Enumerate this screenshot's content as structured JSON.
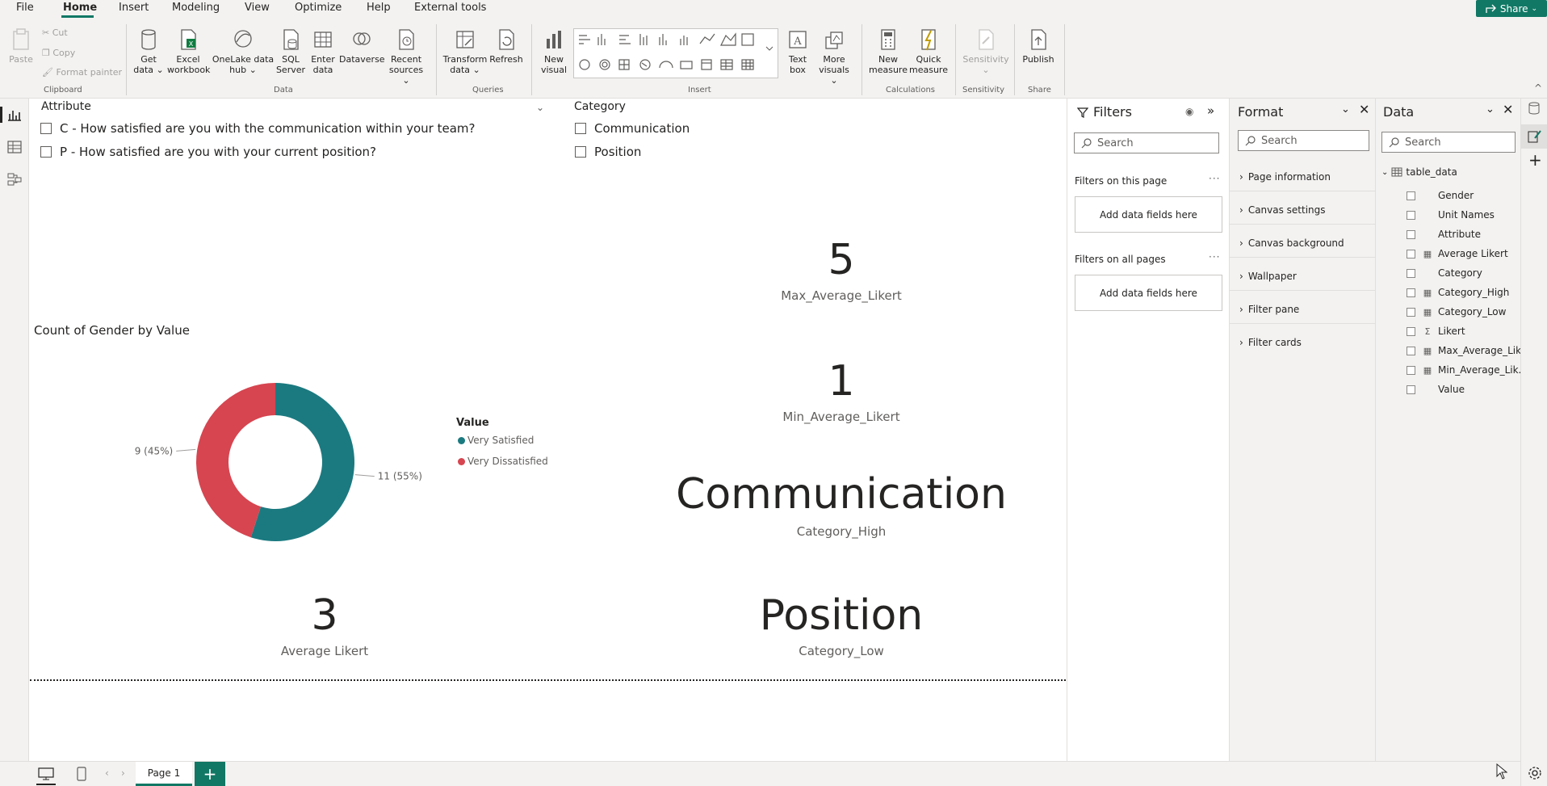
{
  "menu": {
    "items": [
      "File",
      "Home",
      "Insert",
      "Modeling",
      "View",
      "Optimize",
      "Help",
      "External tools"
    ],
    "share_label": "Share"
  },
  "ribbon": {
    "clipboard": {
      "paste": "Paste",
      "cut": "Cut",
      "copy": "Copy",
      "format_painter": "Format painter",
      "group": "Clipboard"
    },
    "data": {
      "get_data": "Get data",
      "excel": "Excel workbook",
      "onelake": "OneLake data hub",
      "sql": "SQL Server",
      "enter_data": "Enter data",
      "dataverse": "Dataverse",
      "recent": "Recent sources",
      "group": "Data"
    },
    "queries": {
      "transform": "Transform data",
      "refresh": "Refresh",
      "group": "Queries"
    },
    "insert": {
      "new_visual": "New visual",
      "text_box": "Text box",
      "more_visuals": "More visuals",
      "group": "Insert"
    },
    "calculations": {
      "new_measure": "New measure",
      "quick_measure": "Quick measure",
      "group": "Calculations"
    },
    "sensitivity": {
      "label": "Sensitivity",
      "group": "Sensitivity"
    },
    "share": {
      "publish": "Publish",
      "group": "Share"
    }
  },
  "canvas": {
    "slicer_attribute": {
      "title": "Attribute",
      "items": [
        "C - How satisfied are you with the communication within your team?",
        "P - How satisfied are you with your current position?"
      ]
    },
    "slicer_category": {
      "title": "Category",
      "items": [
        "Communication",
        "Position"
      ]
    },
    "cards": {
      "max": {
        "value": "5",
        "label": "Max_Average_Likert"
      },
      "min": {
        "value": "1",
        "label": "Min_Average_Likert"
      },
      "high": {
        "value": "Communication",
        "label": "Category_High"
      },
      "low": {
        "value": "Position",
        "label": "Category_Low"
      },
      "avg": {
        "value": "3",
        "label": "Average Likert"
      }
    }
  },
  "chart_data": {
    "type": "pie",
    "title": "Count of Gender by Value",
    "legend_title": "Value",
    "series": [
      {
        "name": "Very Satisfied",
        "value": 11,
        "label": "11 (55%)",
        "color": "#1b7a80"
      },
      {
        "name": "Very Dissatisfied",
        "value": 9,
        "label": "9 (45%)",
        "color": "#d64550"
      }
    ]
  },
  "filters": {
    "title": "Filters",
    "search_placeholder": "Search",
    "on_page": "Filters on this page",
    "on_all_pages": "Filters on all pages",
    "add_fields": "Add data fields here"
  },
  "format": {
    "title": "Format",
    "search_placeholder": "Search",
    "sections": [
      "Page information",
      "Canvas settings",
      "Canvas background",
      "Wallpaper",
      "Filter pane",
      "Filter cards"
    ]
  },
  "data": {
    "title": "Data",
    "search_placeholder": "Search",
    "table": "table_data",
    "fields": [
      {
        "name": "Gender",
        "icon": ""
      },
      {
        "name": "Unit Names",
        "icon": ""
      },
      {
        "name": "Attribute",
        "icon": ""
      },
      {
        "name": "Average Likert",
        "icon": "calc"
      },
      {
        "name": "Category",
        "icon": ""
      },
      {
        "name": "Category_High",
        "icon": "calc"
      },
      {
        "name": "Category_Low",
        "icon": "calc"
      },
      {
        "name": "Likert",
        "icon": "sigma"
      },
      {
        "name": "Max_Average_Lik...",
        "icon": "calc"
      },
      {
        "name": "Min_Average_Lik...",
        "icon": "calc"
      },
      {
        "name": "Value",
        "icon": ""
      }
    ]
  },
  "pages": {
    "tab": "Page 1"
  }
}
